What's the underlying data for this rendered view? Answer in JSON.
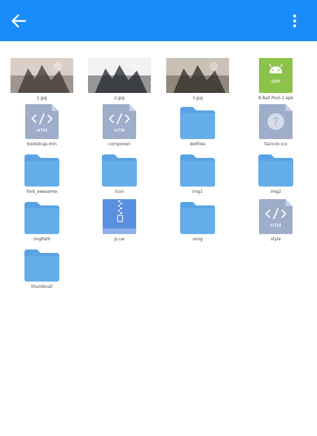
{
  "appbar": {
    "color": "#1a8cf9",
    "back_icon": "arrow-left-icon",
    "menu_icon": "more-vertical-icon"
  },
  "files": [
    {
      "name": "1.jpg",
      "kind": "image"
    },
    {
      "name": "2.jpg",
      "kind": "image"
    },
    {
      "name": "3.jpg",
      "kind": "image"
    },
    {
      "name": "8 Ball Pool-1.apk",
      "kind": "apk",
      "badge": "APP"
    },
    {
      "name": "bootstrap.min",
      "kind": "html",
      "badge": "HTM"
    },
    {
      "name": "componen",
      "kind": "html",
      "badge": "HTM"
    },
    {
      "name": "delFiles",
      "kind": "folder"
    },
    {
      "name": "favicon.ico",
      "kind": "unknown",
      "badge": "?"
    },
    {
      "name": "font_awesome",
      "kind": "folder"
    },
    {
      "name": "icon",
      "kind": "folder"
    },
    {
      "name": "img1",
      "kind": "folder"
    },
    {
      "name": "img2",
      "kind": "folder"
    },
    {
      "name": "imgPath",
      "kind": "folder"
    },
    {
      "name": "js.rar",
      "kind": "archive"
    },
    {
      "name": "song",
      "kind": "folder"
    },
    {
      "name": "style",
      "kind": "html",
      "badge": "HTM"
    },
    {
      "name": "thumbnail",
      "kind": "folder"
    }
  ],
  "colors": {
    "folder": "#66aeea",
    "folder_tab": "#5aa3e2",
    "doc": "#9eadc9",
    "doc_fold": "#c8d2e4",
    "apk": "#8bc34a",
    "archive": "#5b8fe0"
  }
}
